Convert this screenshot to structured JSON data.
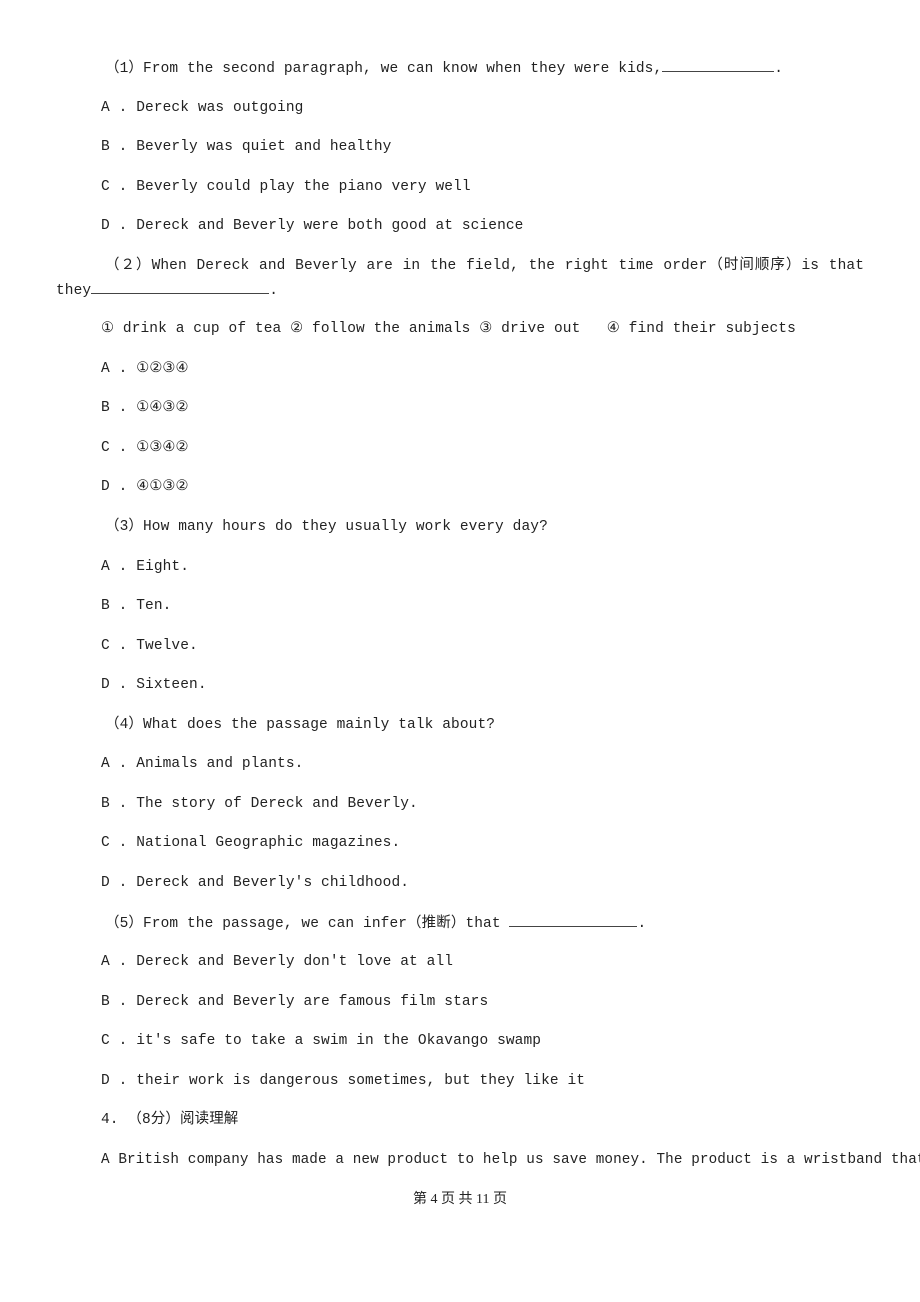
{
  "questions": [
    {
      "stem_before": "（1）From the second paragraph, we can know when they were kids,",
      "stem_after": ".",
      "options": [
        {
          "letter": "A .",
          "text": "Dereck was outgoing"
        },
        {
          "letter": "B .",
          "text": "Beverly was quiet and healthy"
        },
        {
          "letter": "C .",
          "text": "Beverly could play the piano very well"
        },
        {
          "letter": "D .",
          "text": "Dereck and Beverly were both good at science"
        }
      ]
    },
    {
      "stem_line1": "（２）When Dereck and Beverly are in the field, the right time order（时间顺序）is that",
      "stem_line2_before": "they",
      "stem_after": ".",
      "items": "① drink a cup of tea ② follow the animals ③ drive out   ④ find their subjects",
      "options": [
        {
          "letter": "A .",
          "text": "①②③④"
        },
        {
          "letter": "B .",
          "text": "①④③②"
        },
        {
          "letter": "C .",
          "text": "①③④②"
        },
        {
          "letter": "D .",
          "text": "④①③②"
        }
      ]
    },
    {
      "stem": "（3）How many hours do they usually work every day?",
      "options": [
        {
          "letter": "A .",
          "text": "Eight."
        },
        {
          "letter": "B .",
          "text": "Ten."
        },
        {
          "letter": "C .",
          "text": "Twelve."
        },
        {
          "letter": "D .",
          "text": "Sixteen."
        }
      ]
    },
    {
      "stem": "（4）What does the passage mainly talk about?",
      "options": [
        {
          "letter": "A .",
          "text": "Animals and plants."
        },
        {
          "letter": "B .",
          "text": "The story of Dereck and Beverly."
        },
        {
          "letter": "C .",
          "text": "National Geographic magazines."
        },
        {
          "letter": "D .",
          "text": "Dereck and Beverly's childhood."
        }
      ]
    },
    {
      "stem_before": "（5）From the passage, we can infer（推断）that ",
      "stem_after": ".",
      "options": [
        {
          "letter": "A .",
          "text": "Dereck and Beverly don't love at all"
        },
        {
          "letter": "B .",
          "text": "Dereck and Beverly are famous film stars"
        },
        {
          "letter": "C .",
          "text": "it's safe to take a swim in the Okavango swamp"
        },
        {
          "letter": "D .",
          "text": "their work is dangerous sometimes, but they like it"
        }
      ]
    }
  ],
  "section4": {
    "heading": "4. （8分）阅读理解",
    "passage_start": "A British company has made a new product to help us save money. The product is a wristband that"
  },
  "footer": {
    "page_label": "第 4 页 共 11 页"
  }
}
